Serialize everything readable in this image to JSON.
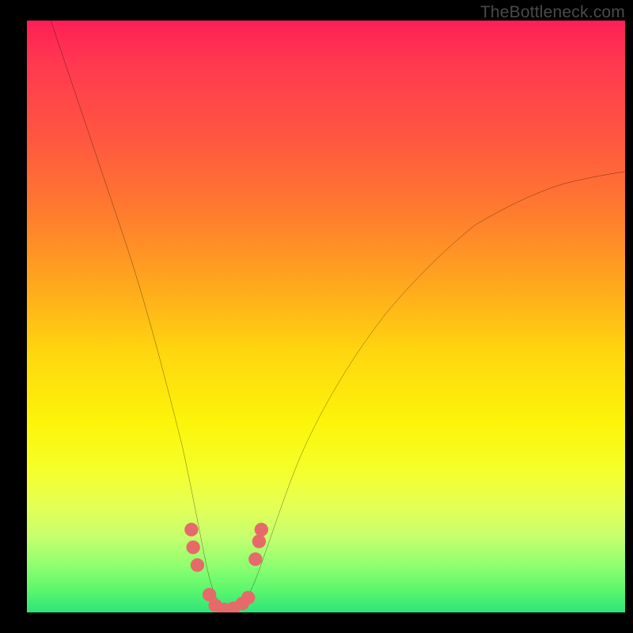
{
  "watermark": {
    "text": "TheBottleneck.com"
  },
  "chart_data": {
    "type": "line",
    "title": "",
    "xlabel": "",
    "ylabel": "",
    "xlim": [
      0,
      100
    ],
    "ylim": [
      0,
      100
    ],
    "grid": false,
    "legend": false,
    "background_gradient": [
      "#ff1f56",
      "#ffd60f",
      "#fcf50a",
      "#2de579"
    ],
    "series": [
      {
        "name": "bottleneck-curve",
        "color": "#000000",
        "x": [
          4,
          8,
          12,
          16,
          20,
          23,
          26,
          28,
          30,
          32,
          34,
          36,
          40,
          45,
          50,
          55,
          60,
          65,
          70,
          75,
          80,
          85,
          90,
          95,
          100
        ],
        "y": [
          100,
          88,
          76,
          64,
          52,
          40,
          28,
          18,
          8,
          2,
          0,
          1,
          6,
          18,
          30,
          40,
          48,
          55,
          60,
          64,
          67,
          70,
          72,
          73,
          74
        ]
      }
    ],
    "markers": [
      {
        "name": "left-cluster",
        "color": "#e76a6a",
        "points_x": [
          27.5,
          27.8,
          28.5
        ],
        "points_y": [
          14,
          11,
          8
        ]
      },
      {
        "name": "valley-cluster",
        "color": "#e76a6a",
        "points_x": [
          30.5,
          31.5,
          33.0,
          34.5,
          36.0,
          37.0
        ],
        "points_y": [
          3,
          1.2,
          0.5,
          0.7,
          1.5,
          2.5
        ]
      },
      {
        "name": "right-cluster",
        "color": "#e76a6a",
        "points_x": [
          38.2,
          38.8,
          39.2
        ],
        "points_y": [
          9,
          12,
          14
        ]
      }
    ]
  }
}
